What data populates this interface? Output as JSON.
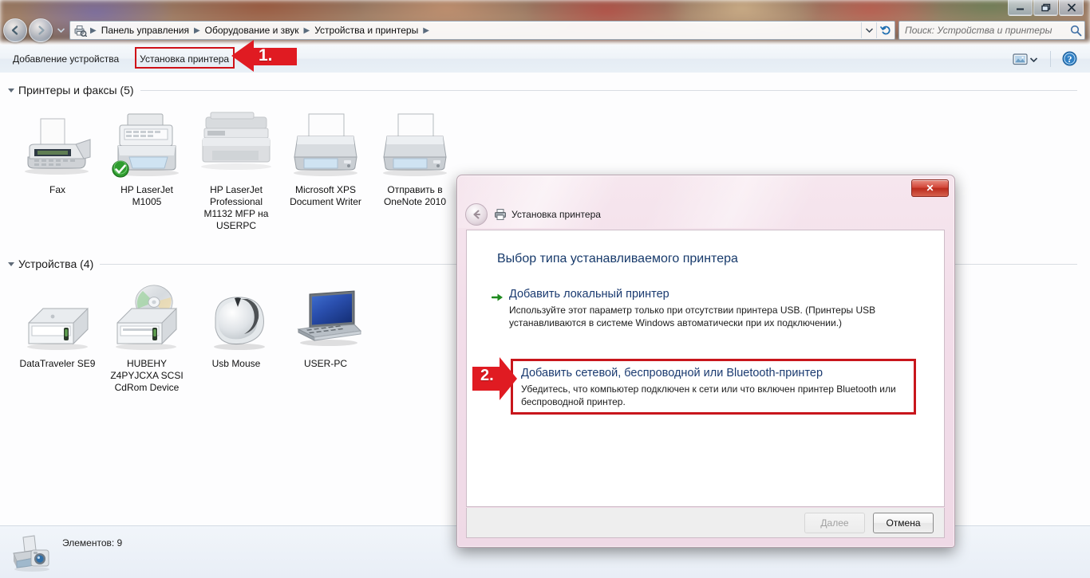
{
  "window": {
    "caption_buttons": [
      {
        "name": "minimize",
        "glyph": "—"
      },
      {
        "name": "restore",
        "glyph": "❐"
      },
      {
        "name": "close",
        "glyph": "✕"
      }
    ]
  },
  "address_bar": {
    "icon": "devices-printers-icon",
    "crumbs": [
      "Панель управления",
      "Оборудование и звук",
      "Устройства и принтеры"
    ],
    "separator": "▶",
    "dropdown_icon": "chevron-down-icon",
    "refresh_icon": "refresh-icon"
  },
  "search": {
    "placeholder": "Поиск: Устройства и принтеры",
    "icon": "search-icon"
  },
  "toolbar": {
    "add_device_label": "Добавление устройства",
    "add_printer_label": "Установка принтера",
    "view_icon": "view-layout-icon",
    "view_dropdown_icon": "chevron-down-icon",
    "help_icon": "help-icon"
  },
  "content": {
    "groups": [
      {
        "id": "printers",
        "label": "Принтеры и факсы (5)",
        "items": [
          {
            "label": "Fax",
            "icon": "fax-machine-icon",
            "default": false
          },
          {
            "label": "HP LaserJet M1005",
            "icon": "laser-printer-icon",
            "default": true
          },
          {
            "label": "HP LaserJet Professional M1132 MFP на USERPC",
            "icon": "mfp-printer-offline-icon",
            "default": false
          },
          {
            "label": "Microsoft XPS Document Writer",
            "icon": "virtual-printer-icon",
            "default": false
          },
          {
            "label": "Отправить в OneNote 2010",
            "icon": "virtual-printer-icon",
            "default": false
          }
        ]
      },
      {
        "id": "devices",
        "label": "Устройства (4)",
        "items": [
          {
            "label": "DataTraveler SE9",
            "icon": "usb-drive-icon"
          },
          {
            "label": "HUBEHY Z4PYJCXA SCSI CdRom Device",
            "icon": "cdrom-drive-icon"
          },
          {
            "label": "Usb Mouse",
            "icon": "mouse-icon"
          },
          {
            "label": "USER-PC",
            "icon": "laptop-icon"
          }
        ]
      }
    ]
  },
  "statusbar": {
    "icon": "printer-camera-icon",
    "text": "Элементов: 9"
  },
  "dialog": {
    "title": "Установка принтера",
    "title_icon": "printer-icon",
    "back_icon": "back-arrow-icon",
    "close_glyph": "✕",
    "heading": "Выбор типа устанавливаемого принтера",
    "options": [
      {
        "id": "local",
        "arrow_icon": "green-arrow-icon",
        "title": "Добавить локальный принтер",
        "description": "Используйте этот параметр только при отсутствии принтера USB. (Принтеры USB устанавливаются в системе Windows автоматически при их подключении.)"
      },
      {
        "id": "network",
        "arrow_icon": "green-arrow-icon",
        "title": "Добавить сетевой, беспроводной или Bluetooth-принтер",
        "description": "Убедитесь, что компьютер подключен к сети или что включен принтер Bluetooth или беспроводной принтер."
      }
    ],
    "buttons": {
      "next_label": "Далее",
      "cancel_label": "Отмена"
    }
  },
  "callouts": [
    {
      "id": "callout-1",
      "number": "1.",
      "direction": "left",
      "target": "add-printer-button"
    },
    {
      "id": "callout-2",
      "number": "2.",
      "direction": "right",
      "target": "network-printer-option"
    }
  ],
  "colors": {
    "accent_red": "#cf1017",
    "highlight_red": "#c8161c",
    "dialog_heading_blue": "#173a6b",
    "option_title_blue": "#1a3a70"
  }
}
